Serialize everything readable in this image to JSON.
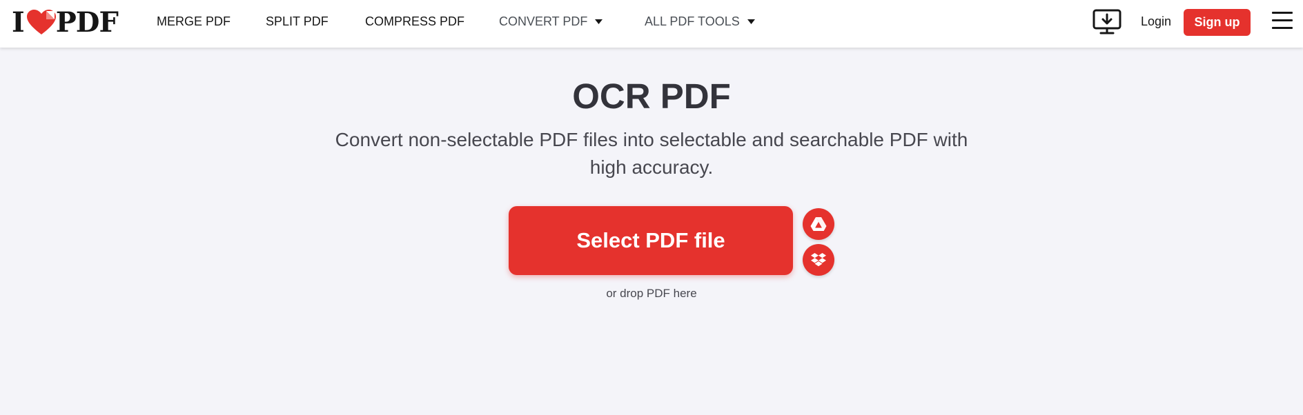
{
  "header": {
    "logo": {
      "prefix": "I",
      "suffix": "PDF",
      "icon": "heart-icon"
    },
    "nav": [
      {
        "label": "MERGE PDF"
      },
      {
        "label": "SPLIT PDF"
      },
      {
        "label": "COMPRESS PDF"
      },
      {
        "label": "CONVERT PDF",
        "icon": "caret-down-icon"
      },
      {
        "label": "ALL PDF TOOLS",
        "icon": "caret-down-icon"
      }
    ],
    "desktop_icon": "desktop-download-icon",
    "login_label": "Login",
    "signup_label": "Sign up",
    "menu_icon": "hamburger-menu-icon"
  },
  "main": {
    "title": "OCR PDF",
    "subtitle": "Convert non-selectable PDF files into selectable and searchable PDF with high accuracy.",
    "select_label": "Select PDF file",
    "drop_hint": "or drop PDF here",
    "cloud_sources": [
      {
        "icon": "google-drive-icon"
      },
      {
        "icon": "dropbox-icon"
      }
    ]
  },
  "colors": {
    "brand_red": "#e5322d",
    "background": "#f4f4f9",
    "header_bg": "#ffffff",
    "text_dark": "#33333b"
  }
}
